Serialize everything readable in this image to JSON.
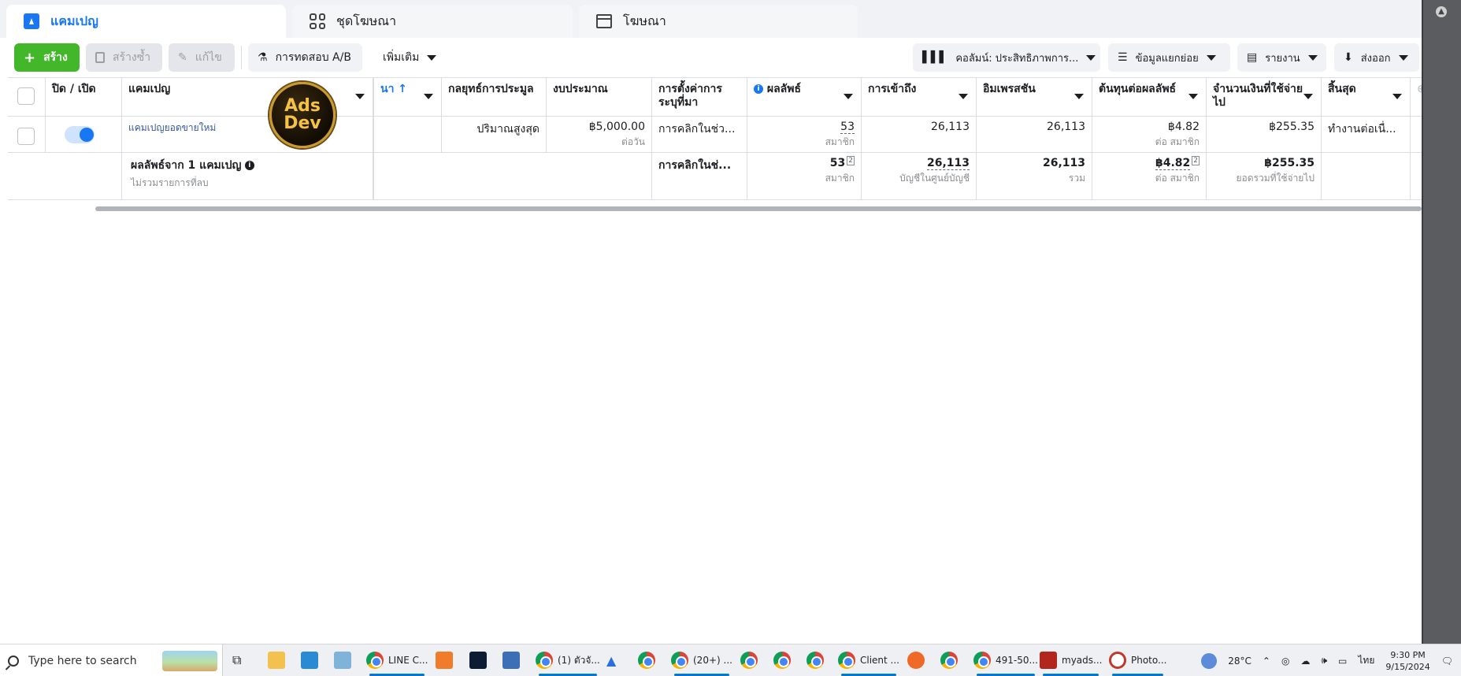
{
  "tabs": [
    {
      "label": "แคมเปญ",
      "active": true,
      "icon": "campaign-icon"
    },
    {
      "label": "ชุดโฆษณา",
      "active": false,
      "icon": "grid-icon"
    },
    {
      "label": "โฆษณา",
      "active": false,
      "icon": "ad-window-icon"
    }
  ],
  "toolbar": {
    "create_label": "สร้าง",
    "duplicate_label": "สร้างซ้ำ",
    "edit_label": "แก้ไข",
    "ab_test_label": "การทดสอบ A/B",
    "more_label": "เพิ่มเติม",
    "columns_label": "คอลัมน์: ประสิทธิภาพการ...",
    "breakdown_label": "ข้อมูลแยกย่อย",
    "reports_label": "รายงาน",
    "export_label": "ส่งออก"
  },
  "table": {
    "headers": {
      "toggle": "ปิด / เปิด",
      "campaign": "แคมเปญ",
      "partial": "นา ↑",
      "bid_strategy": "กลยุทธ์การประมูล",
      "budget": "งบประมาณ",
      "attribution": "การตั้งค่าการระบุที่มา",
      "results": "ผลลัพธ์",
      "reach": "การเข้าถึง",
      "impressions": "อิมเพรสชัน",
      "cost_per_result": "ต้นทุนต่อผลลัพธ์",
      "amount_spent": "จำนวนเงินที่ใช้จ่ายไป",
      "ends": "สิ้นสุด"
    },
    "row": {
      "campaign_name": "แคมเปญยอดขายใหม่",
      "bid_strategy": "ปริมาณสูงสุด",
      "budget": "฿5,000.00",
      "budget_sub": "ต่อวัน",
      "attribution": "การคลิกในช่ว...",
      "results": "53",
      "results_sub": "สมาชิก",
      "reach": "26,113",
      "impressions": "26,113",
      "cost_per_result": "฿4.82",
      "cost_per_result_sub": "ต่อ สมาชิก",
      "amount_spent": "฿255.35",
      "ends": "ทำงานต่อเนื่..."
    },
    "totals": {
      "label": "ผลลัพธ์จาก 1 แคมเปญ",
      "sub": "ไม่รวมรายการที่ลบ",
      "attribution": "การคลิกในช่...",
      "results": "53",
      "results_sub": "สมาชิก",
      "reach": "26,113",
      "reach_sub": "บัญชีในศูนย์บัญชี",
      "impressions": "26,113",
      "impressions_sub": "รวม",
      "cost_per_result": "฿4.82",
      "cost_per_result_sub": "ต่อ สมาชิก",
      "amount_spent": "฿255.35",
      "amount_spent_sub": "ยอดรวมที่ใช้จ่ายไป"
    }
  },
  "logo": {
    "line1": "Ads",
    "line2": "Dev"
  },
  "taskbar": {
    "search_placeholder": "Type here to search",
    "items": [
      "LINE C...",
      "(1) ตัวจั...",
      "(20+) ...",
      "Client ...",
      "491-50...",
      "myads...",
      "Photo..."
    ],
    "temperature": "28°C",
    "language": "ไทย",
    "time": "9:30 PM",
    "date": "9/15/2024"
  },
  "colors": {
    "accent": "#1877f2",
    "create_button": "#42b72a"
  }
}
